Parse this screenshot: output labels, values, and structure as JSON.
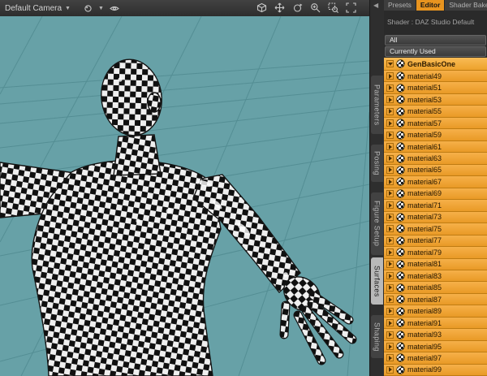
{
  "viewport": {
    "camera": {
      "label": "Default Camera"
    },
    "tool_icons": [
      "cube-icon",
      "pan-icon",
      "orbit-icon",
      "zoom-in-icon",
      "zoom-region-icon",
      "frame-icon"
    ],
    "colors": {
      "background": "#67a1a7",
      "grid": "#548e94"
    }
  },
  "side_tabs": [
    {
      "label": "Parameters",
      "active": false
    },
    {
      "label": "Posing",
      "active": false
    },
    {
      "label": "Figure Setup",
      "active": false
    },
    {
      "label": "Surfaces",
      "active": true
    },
    {
      "label": "Shaping",
      "active": false
    }
  ],
  "panel": {
    "tabs": [
      {
        "label": "Presets",
        "active": false
      },
      {
        "label": "Editor",
        "active": true
      },
      {
        "label": "Shader Bake",
        "active": false
      }
    ],
    "shader_label": "Shader : DAZ Studio Default",
    "buttons": {
      "all": "All",
      "currently_used": "Currently Used"
    },
    "root": {
      "label": "GenBasicOne"
    },
    "materials": [
      "material49",
      "material51",
      "material53",
      "material55",
      "material57",
      "material59",
      "material61",
      "material63",
      "material65",
      "material67",
      "material69",
      "material71",
      "material73",
      "material75",
      "material77",
      "material79",
      "material81",
      "material83",
      "material85",
      "material87",
      "material89",
      "material91",
      "material93",
      "material95",
      "material97",
      "material99"
    ],
    "colors": {
      "row_orange": "#f2a73a",
      "active_tab_orange": "#e8941f"
    }
  }
}
